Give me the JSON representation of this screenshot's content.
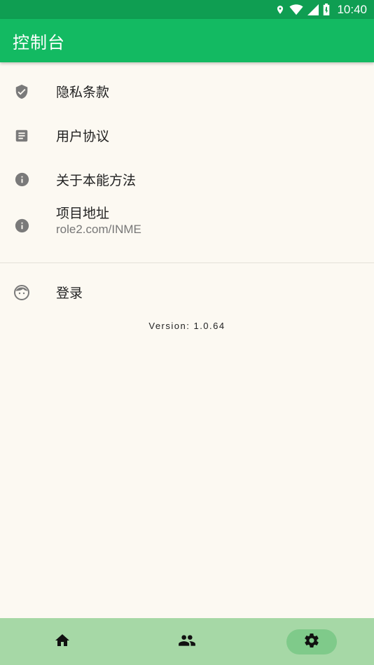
{
  "status_bar": {
    "time": "10:40",
    "icons": [
      "location-icon",
      "wifi-icon",
      "signal-icon",
      "battery-icon"
    ]
  },
  "app_bar": {
    "title": "控制台"
  },
  "menu": {
    "items": [
      {
        "label": "隐私条款",
        "icon": "shield-check-icon"
      },
      {
        "label": "用户协议",
        "icon": "document-icon"
      },
      {
        "label": "关于本能方法",
        "icon": "info-icon"
      },
      {
        "label": "项目地址",
        "sublabel": "role2.com/INME",
        "icon": "info-icon"
      }
    ],
    "login": {
      "label": "登录",
      "icon": "face-icon"
    }
  },
  "version": "Version: 1.0.64",
  "bottom_nav": {
    "items": [
      {
        "icon": "home-icon",
        "active": false
      },
      {
        "icon": "people-icon",
        "active": false
      },
      {
        "icon": "settings-icon",
        "active": true
      }
    ]
  },
  "colors": {
    "status_bar": "#0F9E52",
    "app_bar": "#13BA62",
    "background": "#FCF9F2",
    "bottom_nav": "#A6D8A6",
    "bottom_nav_active": "#7FCA8A",
    "icon_gray": "#7A7A7A"
  }
}
